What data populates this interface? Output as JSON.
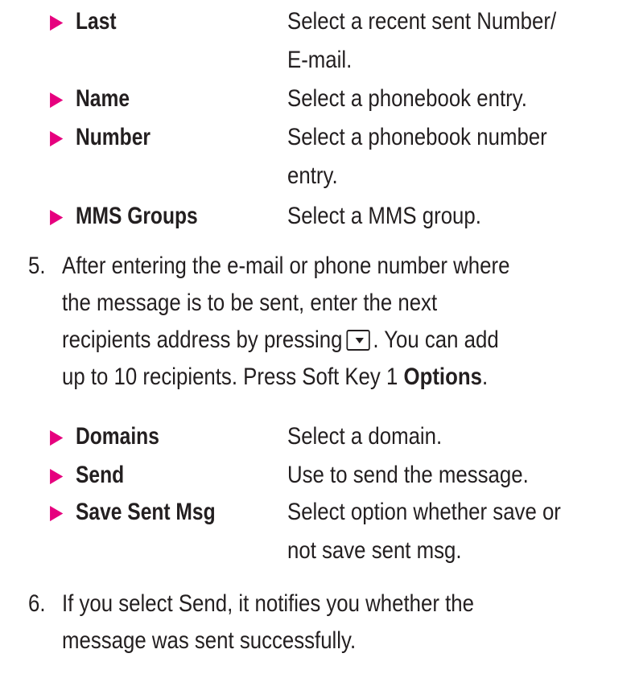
{
  "colors": {
    "bullet": "#e6007e",
    "text": "#231f20"
  },
  "bullet_glyph": "▶",
  "options_group_1": [
    {
      "term": "Last",
      "desc_line1": "Select a recent sent Number/",
      "desc_line2": "E-mail."
    },
    {
      "term": "Name",
      "desc_line1": "Select a phonebook entry."
    },
    {
      "term": "Number",
      "desc_line1": "Select a phonebook number",
      "desc_line2": "entry."
    },
    {
      "term": "MMS Groups",
      "desc_line1": "Select a MMS group."
    }
  ],
  "step5": {
    "number": "5.",
    "line1": "After entering the e-mail or phone number where",
    "line2": "the  message is to be sent, enter the next",
    "line3_before_icon": "recipients  address by pressing",
    "line3_icon": "down-key-icon",
    "line3_after_icon": ". You can add",
    "line4_text": "up  to 10 recipients. Press Soft Key 1",
    "line4_bold": "Options",
    "line4_end": "."
  },
  "options_group_2": [
    {
      "term": "Domains",
      "desc_line1": "Select a domain."
    },
    {
      "term": "Send",
      "desc_line1": "Use to send the message."
    },
    {
      "term": "Save Sent Msg",
      "desc_line1": "Select option whether save or",
      "desc_line2": "not save sent msg."
    }
  ],
  "step6": {
    "number": "6.",
    "line1": "If you select Send, it notifies you whether the",
    "line2": "message was sent successfully."
  }
}
